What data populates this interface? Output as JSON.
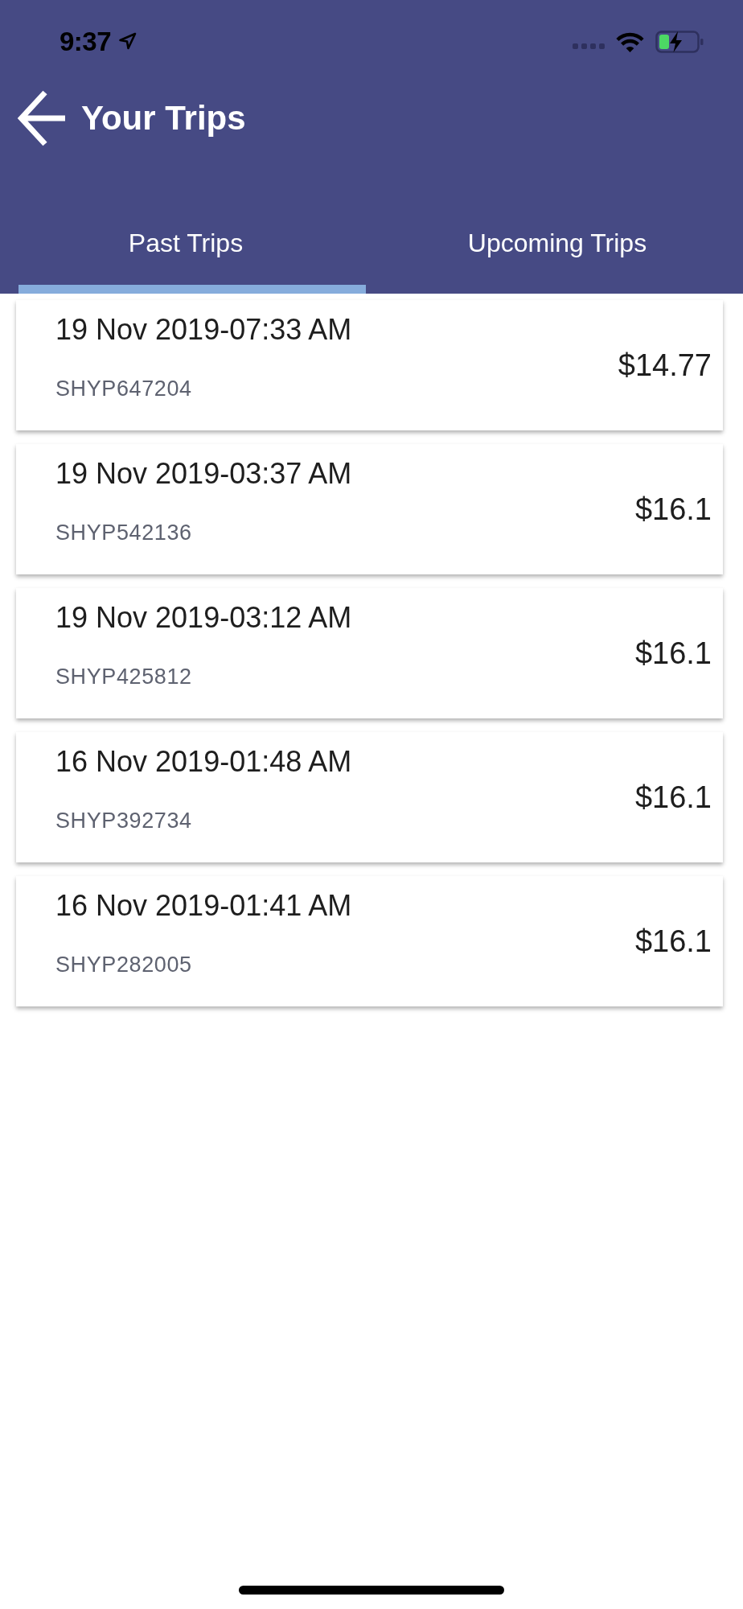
{
  "status_bar": {
    "time": "9:37"
  },
  "header": {
    "title": "Your Trips"
  },
  "tabs": [
    {
      "label": "Past Trips",
      "selected": true
    },
    {
      "label": "Upcoming Trips",
      "selected": false
    }
  ],
  "trips": [
    {
      "datetime": "19 Nov 2019-07:33 AM",
      "booking_code": "SHYP647204",
      "fare": "$14.77"
    },
    {
      "datetime": "19 Nov 2019-03:37 AM",
      "booking_code": "SHYP542136",
      "fare": "$16.1"
    },
    {
      "datetime": "19 Nov 2019-03:12 AM",
      "booking_code": "SHYP425812",
      "fare": "$16.1"
    },
    {
      "datetime": "16 Nov 2019-01:48 AM",
      "booking_code": "SHYP392734",
      "fare": "$16.1"
    },
    {
      "datetime": "16 Nov 2019-01:41 AM",
      "booking_code": "SHYP282005",
      "fare": "$16.1"
    }
  ]
}
